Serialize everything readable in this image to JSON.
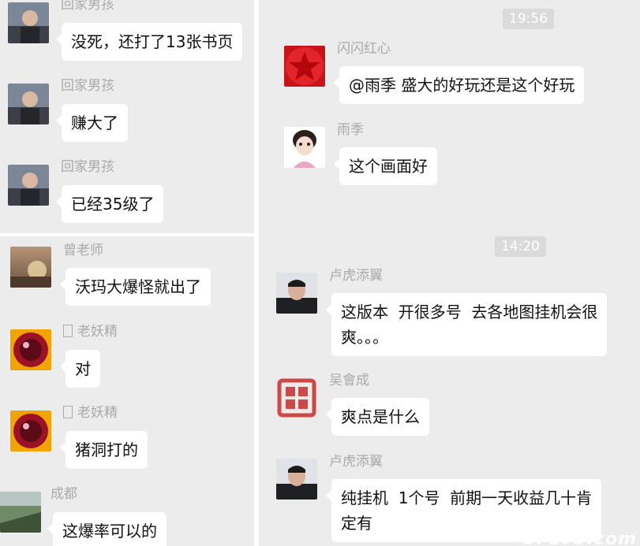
{
  "left_chat_top": {
    "messages": [
      {
        "sender": "回家男孩",
        "text": "没死，还打了13张书页"
      },
      {
        "sender": "回家男孩",
        "text": "赚大了"
      },
      {
        "sender": "回家男孩",
        "text": "已经35级了"
      }
    ]
  },
  "left_chat_bottom": {
    "messages": [
      {
        "sender": "曾老师",
        "text": "沃玛大爆怪就出了"
      },
      {
        "sender": "老妖精",
        "text": "对"
      },
      {
        "sender": "老妖精",
        "text": "猪洞打的"
      },
      {
        "sender": "成都",
        "text": "这爆率可以的"
      }
    ]
  },
  "right_chat": {
    "timestamps": [
      "19:56",
      "14:20"
    ],
    "messages": [
      {
        "sender": "闪闪红心",
        "text": "@雨季 盛大的好玩还是这个好玩"
      },
      {
        "sender": "雨季",
        "text": "这个画面好"
      },
      {
        "sender": "卢虎添翼",
        "text": "这版本  开很多号  去各地图挂机会很\n爽。。。"
      },
      {
        "sender": "吴會成",
        "text": "爽点是什么"
      },
      {
        "sender": "卢虎添翼",
        "text": "纯挂机  1个号  前期一天收益几十肯\n定有"
      }
    ]
  },
  "watermark": "17173.com",
  "colors": {
    "background": "#ececec",
    "bubble": "#ffffff",
    "sender_name": "#aaaaaa",
    "timestamp_bg": "#dadada"
  },
  "icons": {
    "star_avatar": "red-star-icon",
    "seal_avatar": "red-seal-icon"
  }
}
